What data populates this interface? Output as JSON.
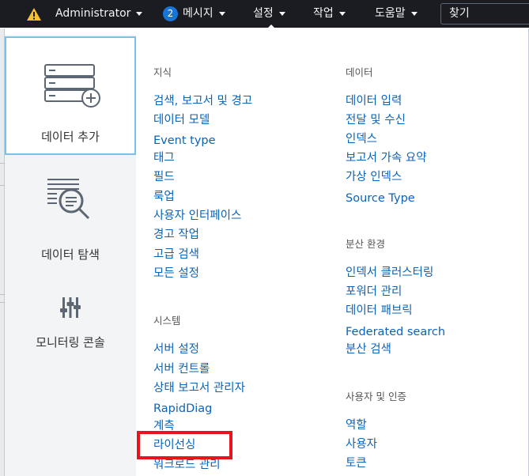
{
  "topbar": {
    "user_label": "Administrator",
    "messages_count": "2",
    "messages_label": "메시지",
    "settings_label": "설정",
    "activity_label": "작업",
    "help_label": "도움말",
    "search_placeholder": "찾기",
    "warning_color": "#f8be34",
    "badge_color": "#1a73d9"
  },
  "icon_cards": [
    {
      "label": "데이터 추가",
      "icon": "server-add-icon"
    },
    {
      "label": "데이터 탐색",
      "icon": "data-explore-icon"
    },
    {
      "label": "모니터링 콘솔",
      "icon": "sliders-icon"
    }
  ],
  "knowledge": {
    "header": "지식",
    "items": [
      "검색, 보고서 및 경고",
      "데이터 모델",
      "Event type",
      "태그",
      "필드",
      "룩업",
      "사용자 인터페이스",
      "경고 작업",
      "고급 검색",
      "모든 설정"
    ]
  },
  "system": {
    "header": "시스템",
    "items": [
      "서버 설정",
      "서버 컨트롤",
      "상태 보고서 관리자",
      "RapidDiag",
      "계측",
      "라이선싱",
      "워크로드 관리"
    ]
  },
  "data": {
    "header": "데이터",
    "items": [
      "데이터 입력",
      "전달 및 수신",
      "인덱스",
      "보고서 가속 요약",
      "가상 인덱스",
      "Source Type"
    ]
  },
  "distributed": {
    "header": "분산 환경",
    "items": [
      "인덱서 클러스터링",
      "포워더 관리",
      "데이터 패브릭",
      "Federated search",
      "분산 검색"
    ]
  },
  "users": {
    "header": "사용자 및 인증",
    "items": [
      "역할",
      "사용자",
      "토큰"
    ]
  },
  "colors": {
    "link": "#0b63b8",
    "highlight": "#e8131b",
    "topbar_bg": "#1a1c21"
  }
}
